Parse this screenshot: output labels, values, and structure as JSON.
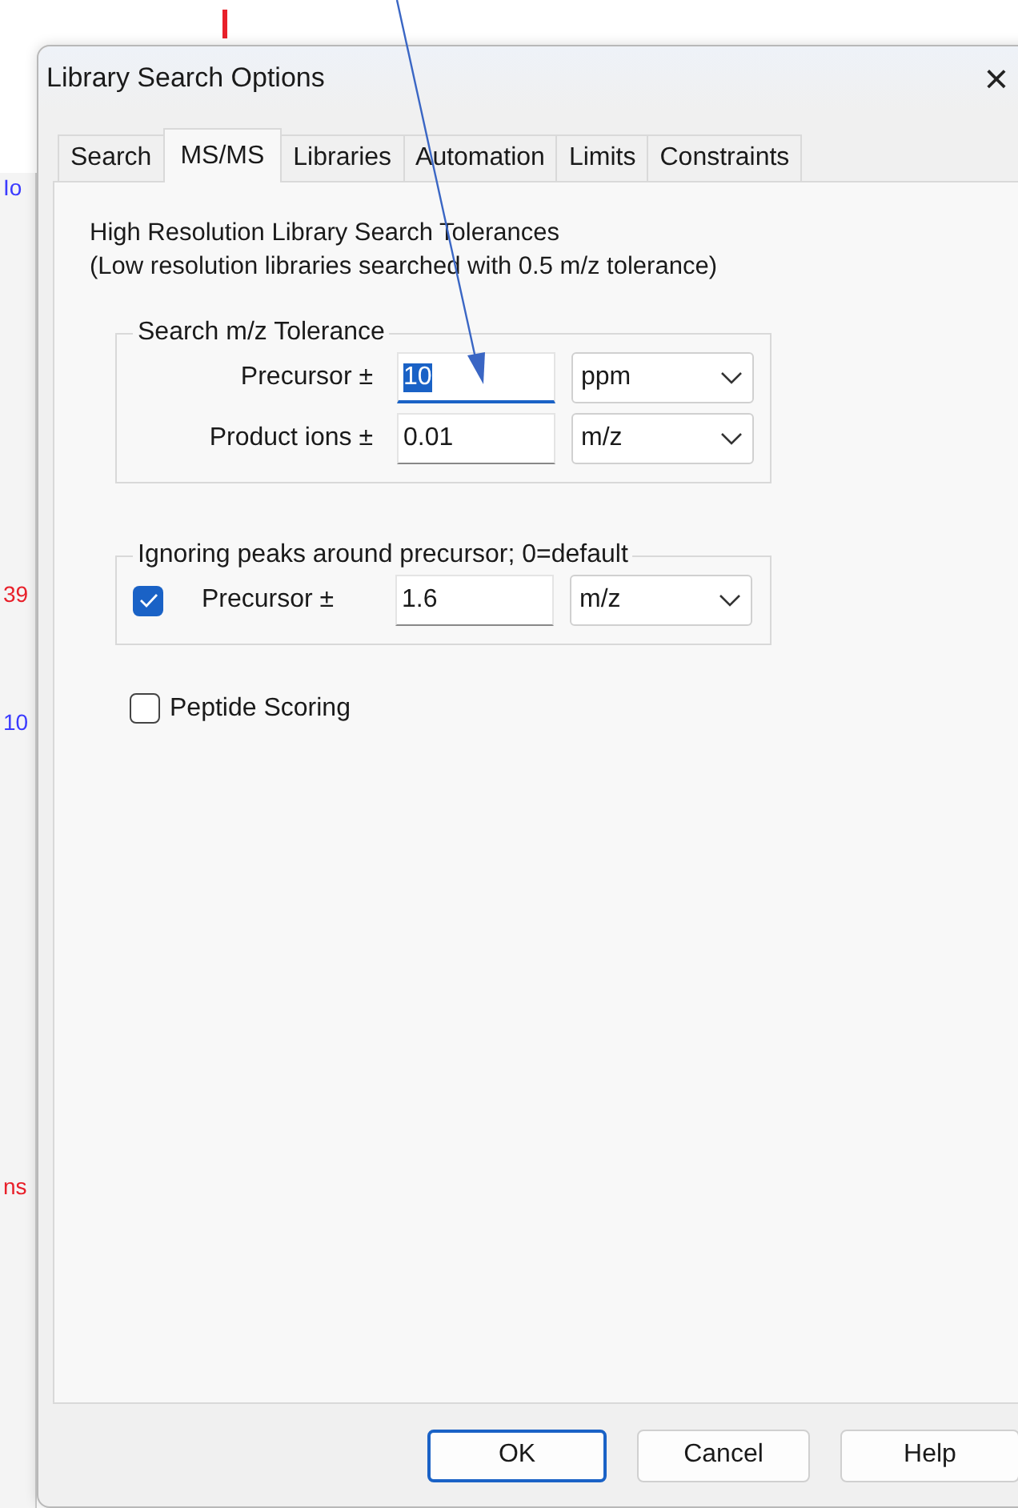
{
  "background": {
    "fragments": [
      {
        "text": "Io",
        "color": "#3b3bff"
      },
      {
        "text": "39",
        "color": "#e8202a"
      },
      {
        "text": "10",
        "color": "#3b3bff"
      },
      {
        "text": "ns",
        "color": "#e8202a"
      }
    ]
  },
  "window": {
    "title": "Library Search Options",
    "close": "×"
  },
  "tabs": [
    {
      "label": "Search",
      "selected": false
    },
    {
      "label": "MS/MS",
      "selected": true
    },
    {
      "label": "Libraries",
      "selected": false
    },
    {
      "label": "Automation",
      "selected": false
    },
    {
      "label": "Limits",
      "selected": false
    },
    {
      "label": "Constraints",
      "selected": false
    }
  ],
  "intro": [
    "High Resolution Library Search Tolerances",
    "(Low resolution libraries searched with 0.5 m/z tolerance)"
  ],
  "tolerance_group": {
    "title": "Search m/z Tolerance",
    "rows": [
      {
        "label": "Precursor ±",
        "value": "10",
        "focused": true,
        "unit": "ppm"
      },
      {
        "label": "Product ions ±",
        "value": "0.01",
        "focused": false,
        "unit": "m/z"
      }
    ]
  },
  "ignore_group": {
    "title": "Ignoring peaks around precursor; 0=default",
    "checked": true,
    "label": "Precursor ±",
    "value": "1.6",
    "unit": "m/z"
  },
  "peptide_scoring": {
    "label": "Peptide Scoring",
    "checked": false
  },
  "buttons": [
    {
      "label": "OK",
      "default": true
    },
    {
      "label": "Cancel",
      "default": false
    },
    {
      "label": "Help",
      "default": false
    }
  ]
}
